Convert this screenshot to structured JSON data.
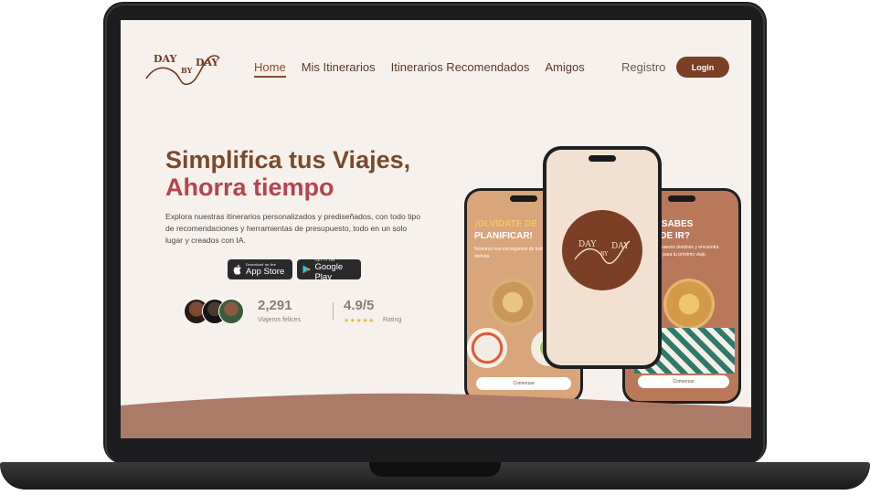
{
  "brand": {
    "logo_text": [
      "DAY",
      "BY",
      "DAY"
    ]
  },
  "nav": {
    "items": [
      {
        "label": "Home",
        "active": true
      },
      {
        "label": "Mis Itinerarios",
        "active": false
      },
      {
        "label": "Itinerarios Recomendados",
        "active": false
      },
      {
        "label": "Amigos",
        "active": false
      }
    ]
  },
  "header": {
    "register_label": "Registro",
    "login_label": "Login"
  },
  "hero": {
    "title_line1": "Simplifica tus Viajes,",
    "title_line2": "Ahorra tiempo",
    "description": "Explora nuestras itinerarios personalizados y prediseñados, con todo tipo de recomendaciones y herramientas de presupuesto, todo en un solo lugar y creados con IA."
  },
  "stores": {
    "apple": {
      "small": "Download on the",
      "big": "App Store"
    },
    "google": {
      "small": "GET IT ON",
      "big": "Google Play"
    }
  },
  "stats": {
    "users_value": "2,291",
    "users_label": "Viajeros felices",
    "rating_value": "4.9/5",
    "rating_label": "Rating",
    "stars": "★★★★★"
  },
  "phones": {
    "left": {
      "heading_line1": "¡OLVÍDATE DE",
      "heading_line2": "PLANIFICAR!",
      "text": "Nosotros nos encargamos de todo, relájate y disfruta",
      "button": "Comenzar"
    },
    "right": {
      "heading_line1": "¿NO SABES",
      "heading_line2": "DÓNDE IR?",
      "text": "Descubre nuevos destinos y encuentra inspiración para tu próximo viaje.",
      "button": "Comenzar"
    }
  },
  "colors": {
    "brand_brown": "#7a3f24",
    "accent_red": "#b4444d",
    "background": "#f6f1ec",
    "wave": "#ab7b68"
  }
}
